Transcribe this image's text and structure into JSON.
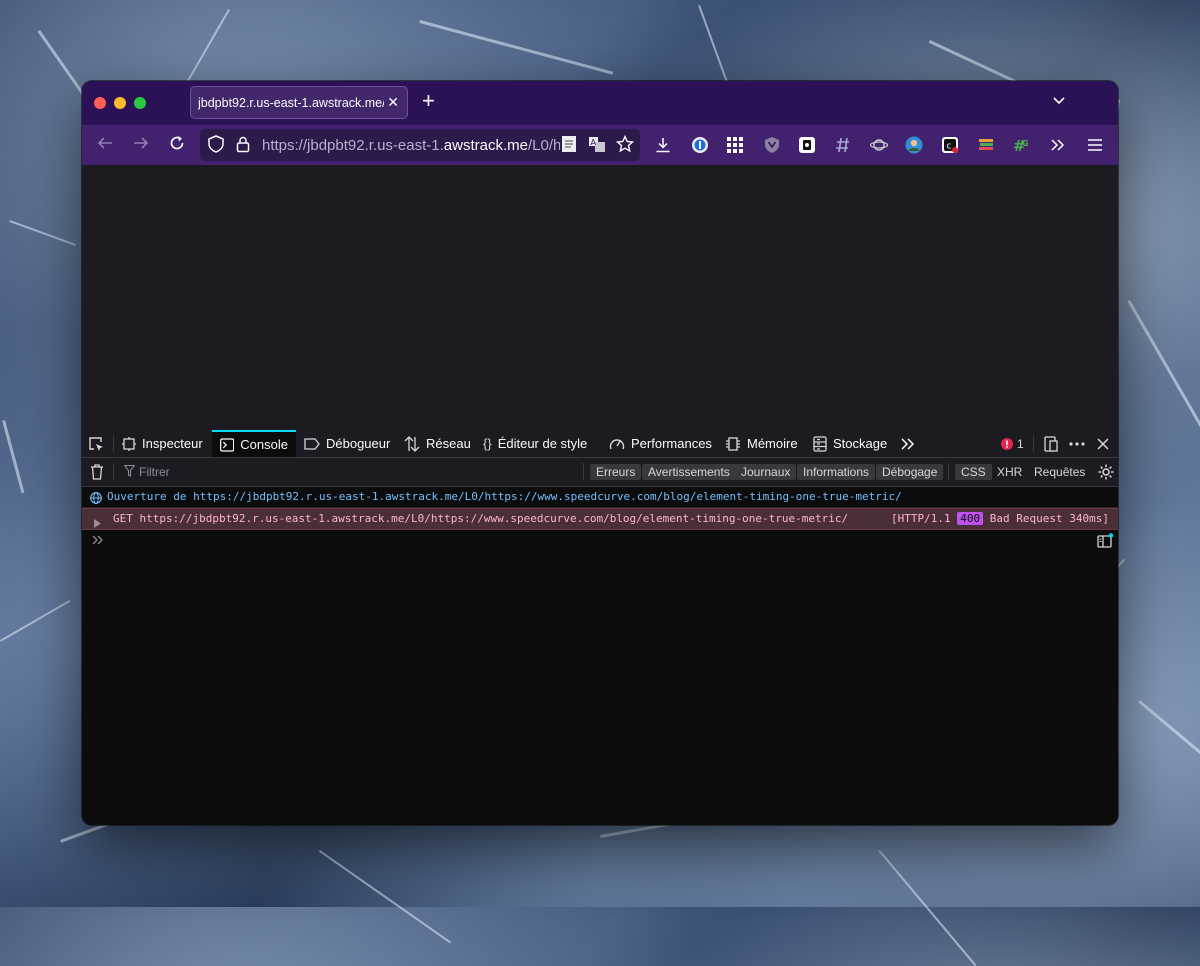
{
  "tab": {
    "title": "jbdpbt92.r.us-east-1.awstrack.me/L0/h",
    "close": "✕"
  },
  "newtab": "+",
  "url": {
    "prefix": "https://jbdpbt92.r.us-east-1.",
    "domain": "awstrack.me",
    "suffix": "/L0/h"
  },
  "devtools": {
    "tabs": [
      {
        "label": "Inspecteur",
        "icon": "inspector-icon"
      },
      {
        "label": "Console",
        "icon": "console-icon"
      },
      {
        "label": "Débogueur",
        "icon": "debugger-icon"
      },
      {
        "label": "Réseau",
        "icon": "network-icon"
      },
      {
        "label": "Éditeur de style",
        "icon": "style-editor-icon"
      },
      {
        "label": "Performances",
        "icon": "performance-icon"
      },
      {
        "label": "Mémoire",
        "icon": "memory-icon"
      },
      {
        "label": "Stockage",
        "icon": "storage-icon"
      }
    ],
    "error_count": "1",
    "filter_placeholder": "Filtrer",
    "filters": [
      "Erreurs",
      "Avertissements",
      "Journaux",
      "Informations",
      "Débogage"
    ],
    "net_filters": [
      "CSS",
      "XHR",
      "Requêtes"
    ],
    "messages": {
      "info": "Ouverture de https://jbdpbt92.r.us-east-1.awstrack.me/L0/https://www.speedcurve.com/blog/element-timing-one-true-metric/",
      "request": "GET https://jbdpbt92.r.us-east-1.awstrack.me/L0/https://www.speedcurve.com/blog/element-timing-one-true-metric/",
      "status_prefix": "[HTTP/1.1",
      "status_code": "400",
      "status_suffix": "Bad Request 340ms]"
    }
  },
  "colors": {
    "accent": "#00ddff",
    "tabbar": "#2b1155",
    "navbar": "#42226f",
    "error_row": "#4b2f36",
    "badge": "#bf51f0"
  }
}
